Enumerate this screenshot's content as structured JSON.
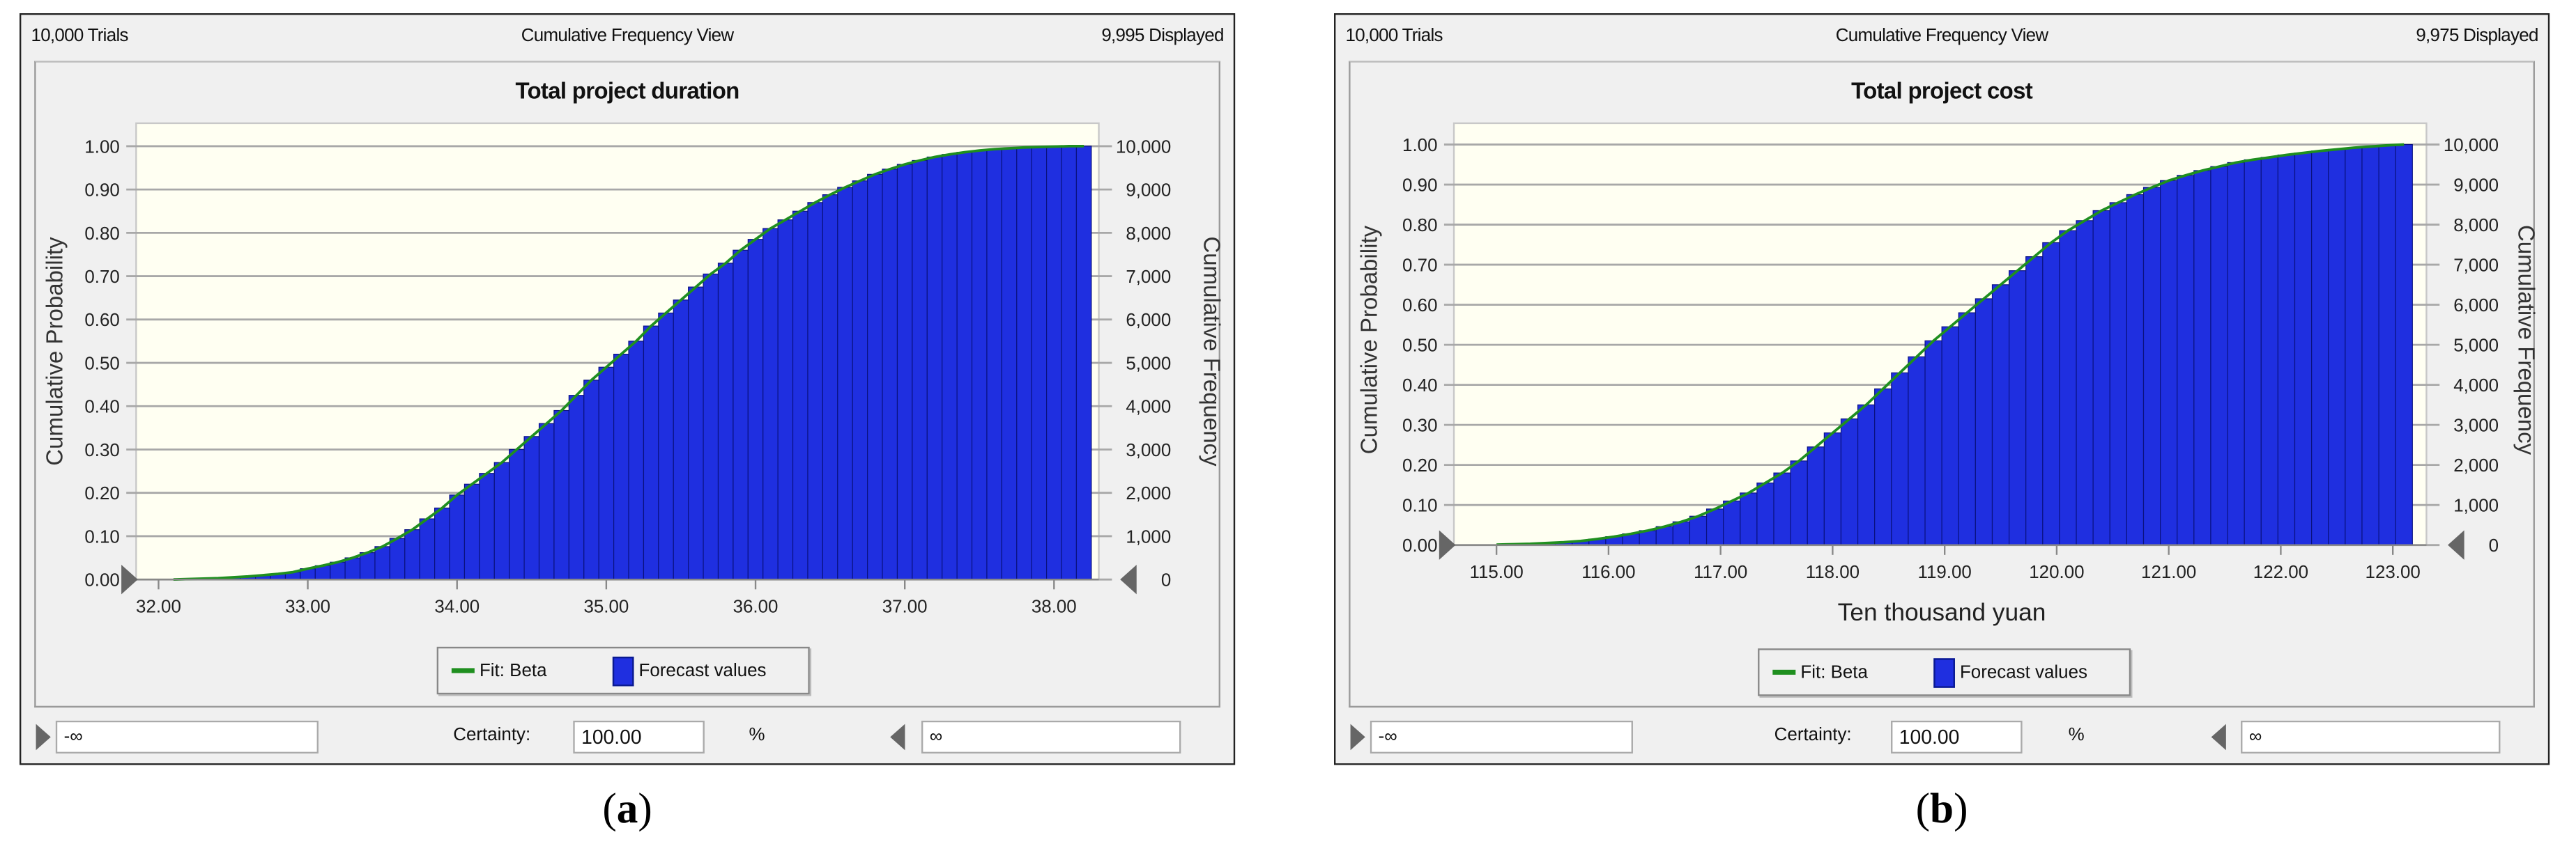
{
  "panels": [
    {
      "trials": "10,000 Trials",
      "view": "Cumulative Frequency View",
      "displayed": "9,995 Displayed",
      "certainty_label": "Certainty:",
      "certainty_value": "100.00",
      "certainty_unit": "%",
      "lower_value": "-∞",
      "upper_value": "∞",
      "caption_open": "(",
      "caption_letter": "a",
      "caption_close": ")"
    },
    {
      "trials": "10,000 Trials",
      "view": "Cumulative Frequency View",
      "displayed": "9,975 Displayed",
      "certainty_label": "Certainty:",
      "certainty_value": "100.00",
      "certainty_unit": "%",
      "lower_value": "-∞",
      "upper_value": "∞",
      "caption_open": "(",
      "caption_letter": "b",
      "caption_close": ")"
    }
  ],
  "colors": {
    "bar": "#1f2fe0",
    "bar_edge": "#0a1280",
    "fit": "#1f8f1f",
    "plot_bg": "#fffff2",
    "grid": "#a8a8a8"
  },
  "chart_data": [
    {
      "type": "bar",
      "title": "Total project duration",
      "xlabel": "",
      "ylabel": "Cumulative Probability",
      "y2label": "Cumulative Frequency",
      "xlim": [
        31.85,
        38.3
      ],
      "ylim": [
        0,
        1
      ],
      "xticks": [
        "32.00",
        "33.00",
        "34.00",
        "35.00",
        "36.00",
        "37.00",
        "38.00"
      ],
      "xtick_values": [
        32,
        33,
        34,
        35,
        36,
        37,
        38
      ],
      "yticks": [
        "0.00",
        "0.10",
        "0.20",
        "0.30",
        "0.40",
        "0.50",
        "0.60",
        "0.70",
        "0.80",
        "0.90",
        "1.00"
      ],
      "y2ticks": [
        "0",
        "1,000",
        "2,000",
        "3,000",
        "4,000",
        "5,000",
        "6,000",
        "7,000",
        "8,000",
        "9,000",
        "10,000"
      ],
      "legend": {
        "fit": "Fit: Beta",
        "bars": "Forecast values",
        "placement": "bottom-center"
      },
      "bin_width": 0.1,
      "x": [
        32.1,
        32.2,
        32.3,
        32.4,
        32.5,
        32.6,
        32.7,
        32.8,
        32.9,
        33.0,
        33.1,
        33.2,
        33.3,
        33.4,
        33.5,
        33.6,
        33.7,
        33.8,
        33.9,
        34.0,
        34.1,
        34.2,
        34.3,
        34.4,
        34.5,
        34.6,
        34.7,
        34.8,
        34.9,
        35.0,
        35.1,
        35.2,
        35.3,
        35.4,
        35.5,
        35.6,
        35.7,
        35.8,
        35.9,
        36.0,
        36.1,
        36.2,
        36.3,
        36.4,
        36.5,
        36.6,
        36.7,
        36.8,
        36.9,
        37.0,
        37.1,
        37.2,
        37.3,
        37.4,
        37.5,
        37.6,
        37.7,
        37.8,
        37.9,
        38.0,
        38.1,
        38.2
      ],
      "values": [
        0.0,
        0.001,
        0.002,
        0.003,
        0.005,
        0.007,
        0.01,
        0.013,
        0.017,
        0.025,
        0.032,
        0.04,
        0.05,
        0.062,
        0.076,
        0.095,
        0.115,
        0.14,
        0.165,
        0.195,
        0.22,
        0.245,
        0.27,
        0.3,
        0.33,
        0.36,
        0.39,
        0.425,
        0.46,
        0.49,
        0.52,
        0.55,
        0.585,
        0.615,
        0.645,
        0.675,
        0.705,
        0.73,
        0.76,
        0.785,
        0.81,
        0.83,
        0.85,
        0.87,
        0.888,
        0.905,
        0.92,
        0.935,
        0.947,
        0.958,
        0.967,
        0.975,
        0.981,
        0.986,
        0.99,
        0.993,
        0.995,
        0.997,
        0.998,
        0.999,
        1.0,
        1.0
      ]
    },
    {
      "type": "bar",
      "title": "Total project cost",
      "xlabel": "Ten thousand yuan",
      "ylabel": "Cumulative Probability",
      "y2label": "Cumulative Frequency",
      "xlim": [
        114.62,
        123.3
      ],
      "ylim": [
        0,
        1
      ],
      "xticks": [
        "115.00",
        "116.00",
        "117.00",
        "118.00",
        "119.00",
        "120.00",
        "121.00",
        "122.00",
        "123.00"
      ],
      "xtick_values": [
        115,
        116,
        117,
        118,
        119,
        120,
        121,
        122,
        123
      ],
      "yticks": [
        "0.00",
        "0.10",
        "0.20",
        "0.30",
        "0.40",
        "0.50",
        "0.60",
        "0.70",
        "0.80",
        "0.90",
        "1.00"
      ],
      "y2ticks": [
        "0",
        "1,000",
        "2,000",
        "3,000",
        "4,000",
        "5,000",
        "6,000",
        "7,000",
        "8,000",
        "9,000",
        "10,000"
      ],
      "legend": {
        "fit": "Fit: Beta",
        "bars": "Forecast values",
        "placement": "bottom-center"
      },
      "bin_width": 0.15,
      "x": [
        115.0,
        115.15,
        115.3,
        115.45,
        115.6,
        115.75,
        115.9,
        116.05,
        116.2,
        116.35,
        116.5,
        116.65,
        116.8,
        116.95,
        117.1,
        117.25,
        117.4,
        117.55,
        117.7,
        117.85,
        118.0,
        118.15,
        118.3,
        118.45,
        118.6,
        118.75,
        118.9,
        119.05,
        119.2,
        119.35,
        119.5,
        119.65,
        119.8,
        119.95,
        120.1,
        120.25,
        120.4,
        120.55,
        120.7,
        120.85,
        121.0,
        121.15,
        121.3,
        121.45,
        121.6,
        121.75,
        121.9,
        122.05,
        122.2,
        122.35,
        122.5,
        122.65,
        122.8,
        122.95,
        123.1
      ],
      "values": [
        0.001,
        0.002,
        0.003,
        0.005,
        0.007,
        0.01,
        0.015,
        0.021,
        0.028,
        0.036,
        0.046,
        0.058,
        0.072,
        0.09,
        0.11,
        0.13,
        0.155,
        0.18,
        0.21,
        0.245,
        0.28,
        0.315,
        0.35,
        0.39,
        0.43,
        0.47,
        0.51,
        0.545,
        0.58,
        0.615,
        0.65,
        0.685,
        0.72,
        0.755,
        0.785,
        0.81,
        0.835,
        0.855,
        0.875,
        0.893,
        0.91,
        0.923,
        0.935,
        0.945,
        0.955,
        0.962,
        0.968,
        0.974,
        0.979,
        0.984,
        0.988,
        0.992,
        0.995,
        0.998,
        1.0
      ]
    }
  ]
}
